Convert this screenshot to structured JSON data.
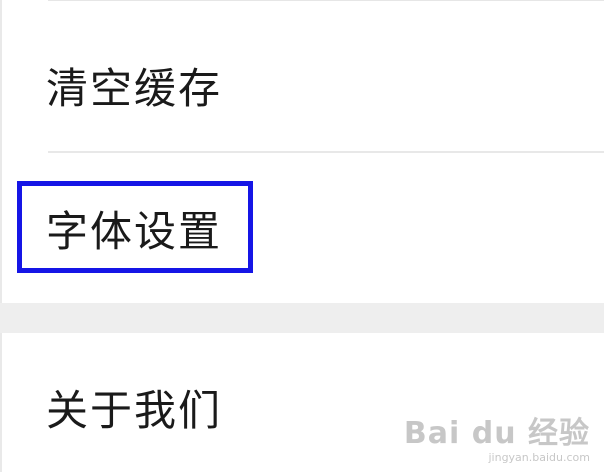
{
  "settings": {
    "items": [
      {
        "label": "清空缓存"
      },
      {
        "label": "字体设置"
      },
      {
        "label": "关于我们"
      }
    ]
  },
  "highlight": {
    "color": "#1515e6"
  },
  "watermark": {
    "brand": "Bai du 经验",
    "url": "jingyan.baidu.com"
  }
}
